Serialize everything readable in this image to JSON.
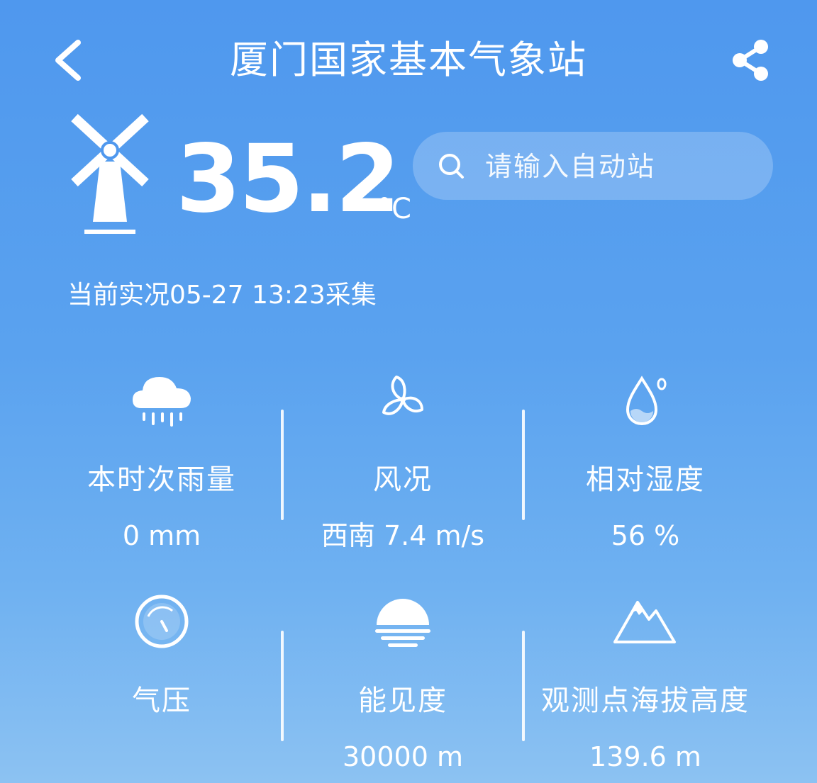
{
  "header": {
    "title": "厦门国家基本气象站",
    "back_icon": "chevron-left-icon",
    "share_icon": "share-icon"
  },
  "current": {
    "temperature": "35.2",
    "unit": "°C",
    "station_icon": "windmill-icon",
    "update_text": "当前实况05-27 13:23采集"
  },
  "search": {
    "placeholder": "请输入自动站",
    "icon": "search-icon"
  },
  "metrics": [
    {
      "icon": "rain-cloud-icon",
      "label": "本时次雨量",
      "value": "0 mm"
    },
    {
      "icon": "fan-wind-icon",
      "label": "风况",
      "value": "西南 7.4 m/s"
    },
    {
      "icon": "humidity-drop-icon",
      "label": "相对湿度",
      "value": "56 %"
    },
    {
      "icon": "pressure-gauge-icon",
      "label": "气压",
      "value": "",
      "value_obscured": true
    },
    {
      "icon": "visibility-sun-icon",
      "label": "能见度",
      "value": "30000 m"
    },
    {
      "icon": "mountain-icon",
      "label": "观测点海拔高度",
      "value": "139.6 m"
    }
  ],
  "colors": {
    "background_top": "#4f98ee",
    "background_bottom": "#8cc2f2",
    "text": "#ffffff"
  }
}
